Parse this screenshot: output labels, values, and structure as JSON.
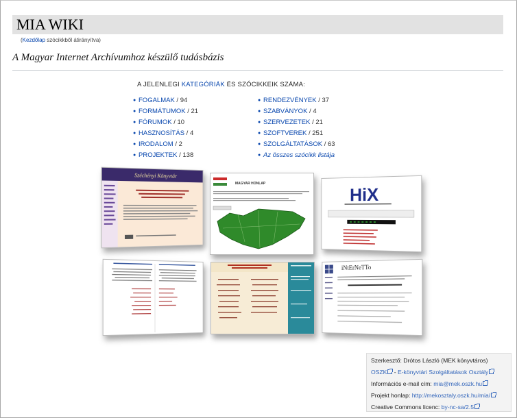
{
  "page": {
    "title": "MIA WIKI",
    "redirect_link": "Kezdőlap",
    "redirect_suffix": " szócikkből átirányítva)",
    "redirect_prefix": "(",
    "tagline": "A Magyar Internet Archívumhoz készülő tudásbázis"
  },
  "categories": {
    "heading_prefix": "A JELENLEGI ",
    "heading_link": "KATEGÓRIÁK",
    "heading_suffix": " ÉS SZÓCIKKEIK SZÁMA:",
    "left": [
      {
        "label": "FOGALMAK",
        "count": " / 94"
      },
      {
        "label": "FORMÁTUMOK",
        "count": " / 21"
      },
      {
        "label": "FÓRUMOK",
        "count": " / 10"
      },
      {
        "label": "HASZNOSÍTÁS",
        "count": " / 4"
      },
      {
        "label": "IRODALOM",
        "count": " / 2"
      },
      {
        "label": "PROJEKTEK",
        "count": " / 138"
      }
    ],
    "right": [
      {
        "label": "RENDEZVÉNYEK",
        "count": " / 37"
      },
      {
        "label": "SZABVÁNYOK",
        "count": " / 4"
      },
      {
        "label": "SZERVEZETEK",
        "count": " / 21"
      },
      {
        "label": "SZOFTVEREK",
        "count": " / 251"
      },
      {
        "label": "SZOLGÁLTATÁSOK",
        "count": " / 63"
      },
      {
        "label": "Az összes szócikk listája",
        "count": ""
      }
    ]
  },
  "thumbnails": {
    "t1_title": "Széchényi Könyvtár",
    "t2_title": "MAGYAR HONLAP",
    "t3_title": "HiX",
    "t6_title": "iNtErNeTTo"
  },
  "infobox": {
    "editor": "Szerkesztő: Drótos László (MEK könyvtáros)",
    "oszk": "OSZK",
    "sep": " - ",
    "dept": "E-könyvtári Szolgáltatások Osztály",
    "email_label": "Információs e-mail cím: ",
    "email": "mia@mek.oszk.hu",
    "homepage_label": "Projekt honlap: ",
    "homepage": "http://mekosztaly.oszk.hu/mia/",
    "license_label": "Creative Commons licenc: ",
    "license": "by-nc-sa/2.5"
  },
  "colors": {
    "link": "#0645ad",
    "title_bar": "#e2e2e2"
  }
}
